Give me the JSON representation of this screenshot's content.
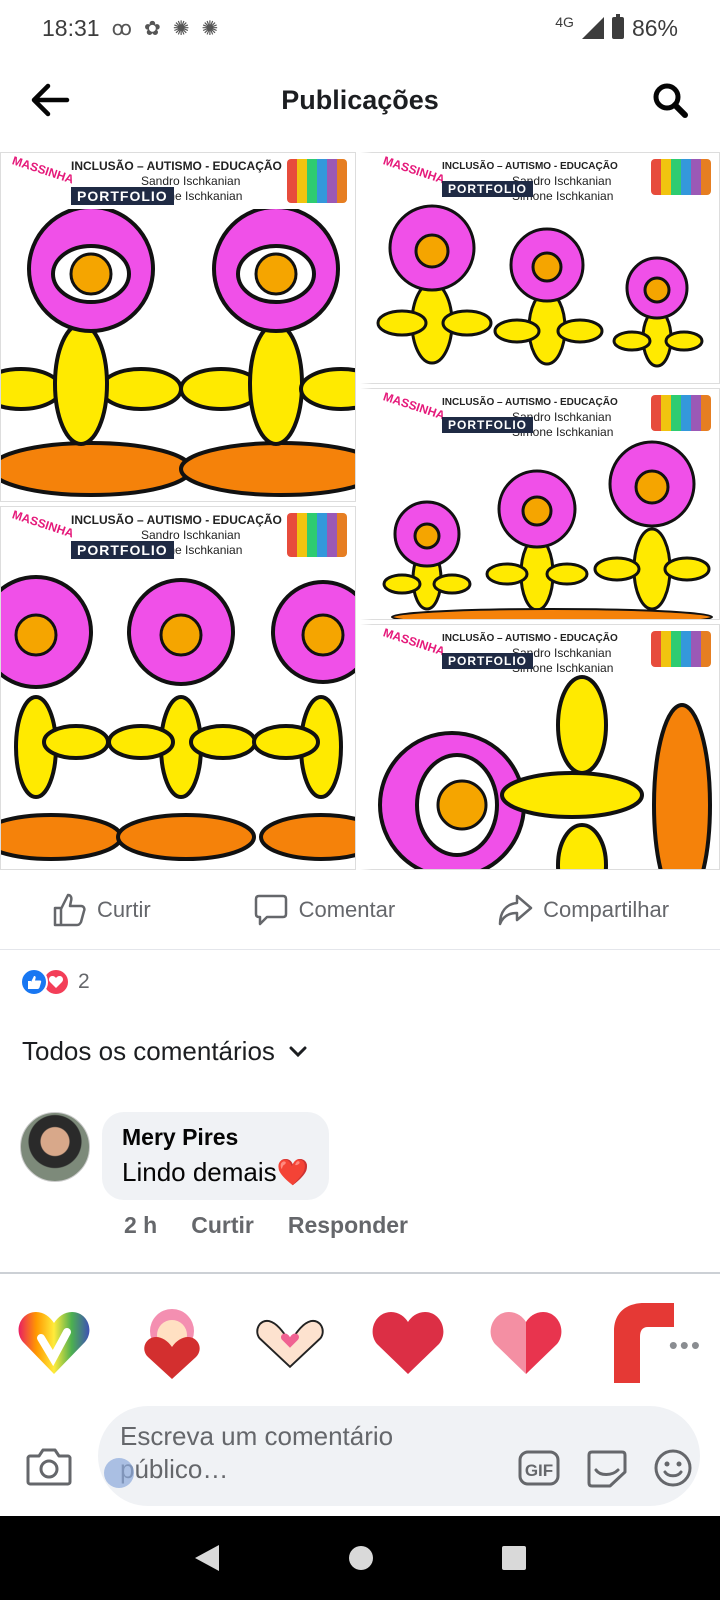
{
  "status": {
    "time": "18:31",
    "network": "4G",
    "battery": "86%"
  },
  "header": {
    "title": "Publicações",
    "back_icon": "arrow-left-icon",
    "search_icon": "search-icon"
  },
  "post_image": {
    "tile_header": "INCLUSÃO – AUTISMO - EDUCAÇÃO",
    "author_1": "Sandro Ischkanian",
    "author_2": "Simone Ischkanian",
    "brand": "PORTFOLIO",
    "logo": "MASSINHA",
    "colors": {
      "petal": "#f050e8",
      "center": "#f5a500",
      "leaf": "#ffea00",
      "pot": "#f5820a"
    }
  },
  "actions": {
    "like": "Curtir",
    "comment": "Comentar",
    "share": "Compartilhar"
  },
  "reactions": {
    "count": "2"
  },
  "comments_filter": {
    "label": "Todos os comentários"
  },
  "comment": {
    "author": "Mery Pires",
    "text": "Lindo demais",
    "emoji": "❤️",
    "time": "2 h",
    "like": "Curtir",
    "reply": "Responder"
  },
  "composer": {
    "placeholder": "Escreva um comentário público…",
    "gif_label": "GIF"
  },
  "accent": "#1877f2"
}
